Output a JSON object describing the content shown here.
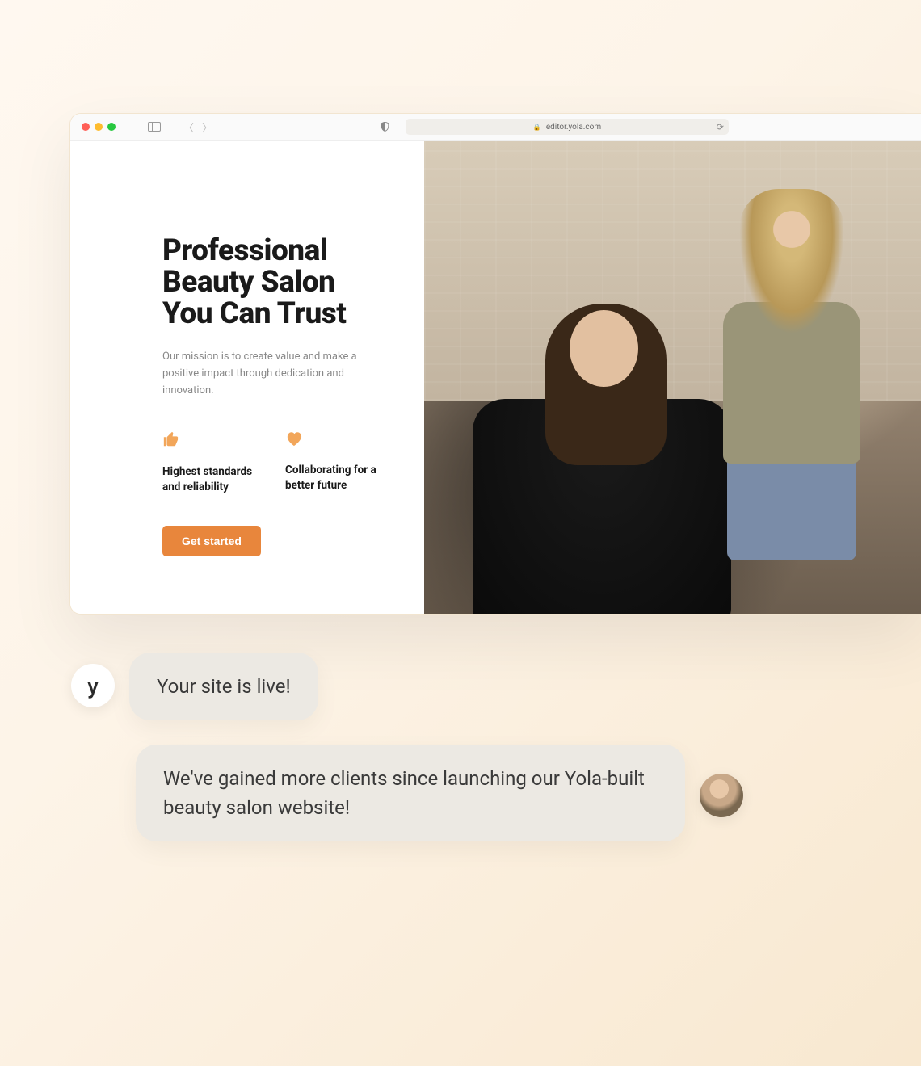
{
  "browser": {
    "url": "editor.yola.com"
  },
  "hero": {
    "title_line1": "Professional",
    "title_line2": "Beauty Salon",
    "title_line3": "You Can Trust",
    "subtitle": "Our mission is to create value and make a positive impact through dedication and innovation.",
    "cta_label": "Get started"
  },
  "features": [
    {
      "icon": "thumbs-up",
      "text": "Highest standards and reliability"
    },
    {
      "icon": "heart",
      "text": "Collaborating for a better future"
    }
  ],
  "chat": {
    "system_avatar_letter": "y",
    "system_message": "Your site is live!",
    "user_message": "We've gained more clients since launching our Yola-built beauty salon website!"
  }
}
